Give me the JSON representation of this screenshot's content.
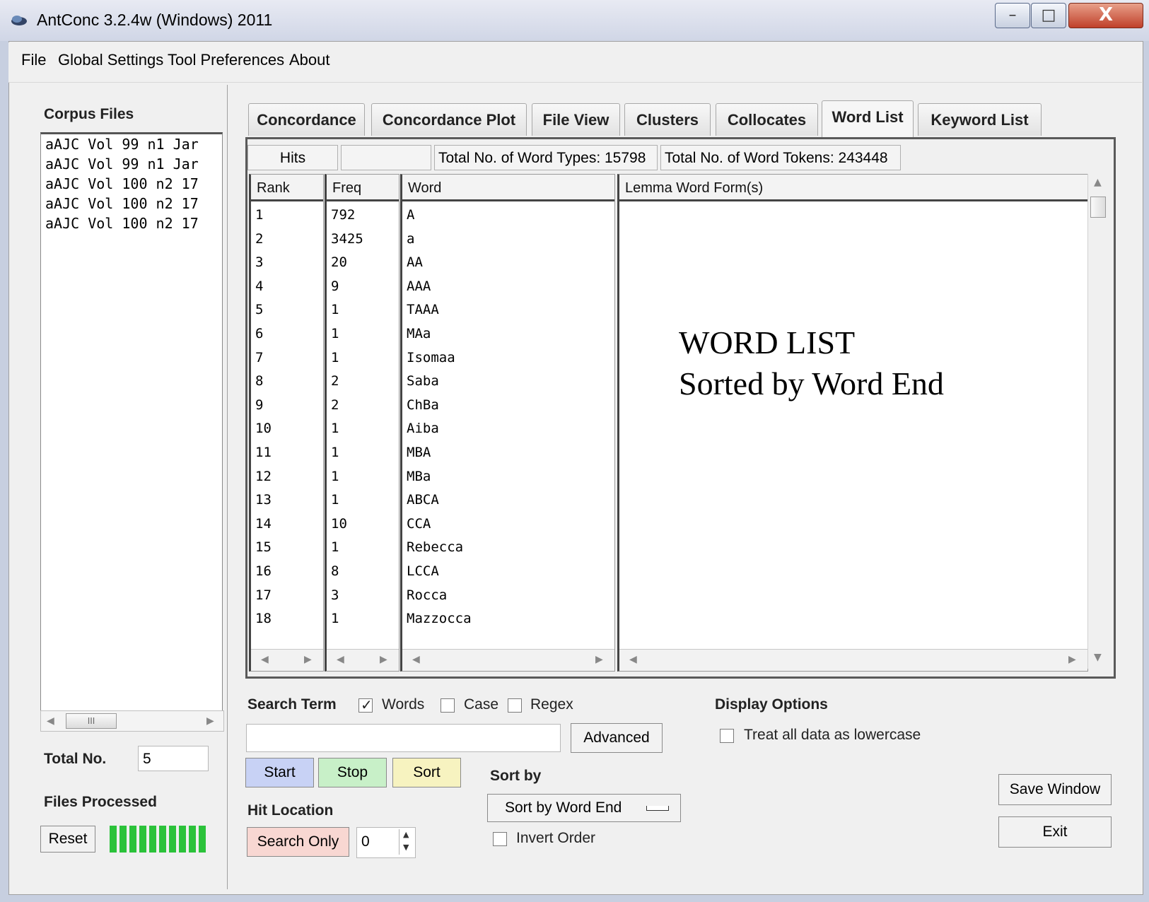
{
  "window": {
    "title": "AntConc 3.2.4w (Windows) 2011",
    "min_glyph": "–",
    "max_glyph": "□",
    "close_glyph": "X"
  },
  "menu": [
    "File",
    "Global Settings",
    "Tool Preferences",
    "About"
  ],
  "corpus": {
    "heading": "Corpus Files",
    "files": [
      "aAJC Vol 99 n1 Jar",
      "aAJC Vol 99 n1 Jar",
      "aAJC Vol 100 n2 17",
      "aAJC Vol 100 n2 17",
      "aAJC Vol 100 n2 17"
    ],
    "scroll_thumb": "III",
    "total_label": "Total No.",
    "total_value": "5",
    "processed_label": "Files Processed",
    "reset_label": "Reset",
    "progress": 1.0
  },
  "tabs": [
    "Concordance",
    "Concordance Plot",
    "File View",
    "Clusters",
    "Collocates",
    "Word List",
    "Keyword List"
  ],
  "active_tab": "Word List",
  "info": {
    "hits": "Hits",
    "blank": "",
    "types": "Total No. of Word Types: 15798",
    "tokens": "Total No. of Word Tokens: 243448"
  },
  "columns": {
    "rank": "Rank",
    "freq": "Freq",
    "word": "Word",
    "lemma": "Lemma Word Form(s)"
  },
  "rows": [
    {
      "rank": "1",
      "freq": "792",
      "word": "A"
    },
    {
      "rank": "2",
      "freq": "3425",
      "word": "a"
    },
    {
      "rank": "3",
      "freq": "20",
      "word": "AA"
    },
    {
      "rank": "4",
      "freq": "9",
      "word": "AAA"
    },
    {
      "rank": "5",
      "freq": "1",
      "word": "TAAA"
    },
    {
      "rank": "6",
      "freq": "1",
      "word": "MAa"
    },
    {
      "rank": "7",
      "freq": "1",
      "word": "Isomaa"
    },
    {
      "rank": "8",
      "freq": "2",
      "word": "Saba"
    },
    {
      "rank": "9",
      "freq": "2",
      "word": "ChBa"
    },
    {
      "rank": "10",
      "freq": "1",
      "word": "Aiba"
    },
    {
      "rank": "11",
      "freq": "1",
      "word": "MBA"
    },
    {
      "rank": "12",
      "freq": "1",
      "word": "MBa"
    },
    {
      "rank": "13",
      "freq": "1",
      "word": "ABCA"
    },
    {
      "rank": "14",
      "freq": "10",
      "word": "CCA"
    },
    {
      "rank": "15",
      "freq": "1",
      "word": "Rebecca"
    },
    {
      "rank": "16",
      "freq": "8",
      "word": "LCCA"
    },
    {
      "rank": "17",
      "freq": "3",
      "word": "Rocca"
    },
    {
      "rank": "18",
      "freq": "1",
      "word": "Mazzocca"
    }
  ],
  "overlay": {
    "line1": "WORD LIST",
    "line2": "Sorted by Word End"
  },
  "search": {
    "label": "Search Term",
    "words_label": "Words",
    "words_checked": true,
    "case_label": "Case",
    "case_checked": false,
    "regex_label": "Regex",
    "regex_checked": false,
    "value": "",
    "advanced_label": "Advanced"
  },
  "actions": {
    "start": "Start",
    "stop": "Stop",
    "sort": "Sort",
    "start_color": "#c8d2f5",
    "stop_color": "#c8f0c8",
    "sort_color": "#f7f3c0"
  },
  "hit_location": {
    "label": "Hit Location",
    "search_only": "Search Only",
    "search_only_color": "#f8d7d2",
    "value": "0"
  },
  "sort_by": {
    "label": "Sort by",
    "selected": "Sort by Word End",
    "invert_label": "Invert Order",
    "invert_checked": false
  },
  "display": {
    "label": "Display Options",
    "lowercase_label": "Treat all data as lowercase",
    "lowercase_checked": false
  },
  "save_window": "Save Window",
  "exit": "Exit",
  "accent_progress": "#2bc23a"
}
